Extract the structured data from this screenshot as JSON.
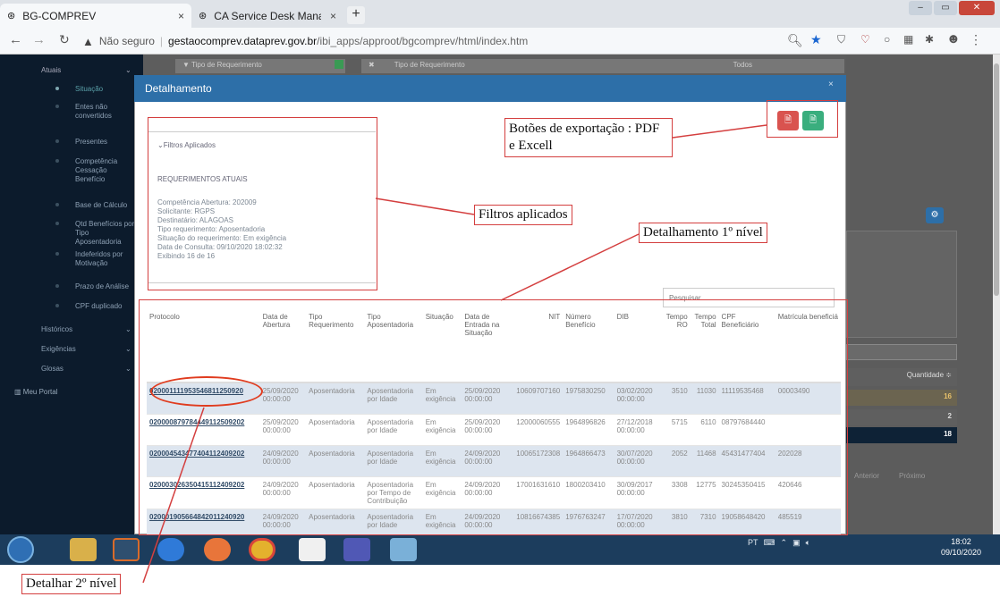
{
  "browser": {
    "tabs": [
      {
        "title": "BG-COMPREV",
        "close": "×"
      },
      {
        "title": "CA Service Desk Manager - S54 |",
        "close": "×"
      }
    ],
    "new_tab": "+",
    "security": "Não seguro",
    "url_host": "gestaocomprev.dataprev.gov.br",
    "url_path": "/ibi_apps/approot/bgcomprev/html/index.htm"
  },
  "sidebar": {
    "items": [
      {
        "label": "Atuais"
      },
      {
        "label": "Situação"
      },
      {
        "label": "Entes não convertidos"
      },
      {
        "label": "Presentes"
      },
      {
        "label": "Competência Cessação Benefício"
      },
      {
        "label": "Base de Cálculo"
      },
      {
        "label": "Qtd Benefícios por Tipo Aposentadoria"
      },
      {
        "label": "Indeferidos por Motivação"
      },
      {
        "label": "Prazo de Análise"
      },
      {
        "label": "CPF duplicado"
      },
      {
        "label": "Históricos"
      },
      {
        "label": "Exigências"
      },
      {
        "label": "Glosas"
      },
      {
        "label": "Meu Portal"
      }
    ]
  },
  "background": {
    "filter_label": "Tipo de Requerimento",
    "filter_label2": "Tipo de Requerimento",
    "filter_value": "Todos",
    "qty_header": "Quantidade ≑",
    "qty_values": [
      "16",
      "2",
      "18"
    ],
    "prev": "Anterior",
    "next": "Próximo"
  },
  "modal": {
    "title": "Detalhamento",
    "close": "×",
    "filters_toggle": "Filtros Aplicados",
    "subtitle": "REQUERIMENTOS ATUAIS",
    "filter_lines": [
      "Competência Abertura: 202009",
      "Solicitante: RGPS",
      "Destinatário: ALAGOAS",
      "Tipo requerimento: Aposentadoria",
      "Situação do requerimento: Em exigência",
      "Data de Consulta: 09/10/2020 18:02:32",
      "Exibindo 16 de 16"
    ],
    "search_placeholder": "Pesquisar",
    "columns": [
      "Protocolo",
      "Data de Abertura",
      "Tipo Requerimento",
      "Tipo Aposentadoria",
      "Situação",
      "Data de Entrada na Situação",
      "NIT",
      "Número Benefício",
      "DIB",
      "Tempo RO",
      "Tempo Total",
      "CPF Beneficiário",
      "Matrícula beneficiá"
    ],
    "rows": [
      [
        "020001111953546811250920",
        "25/09/2020 00:00:00",
        "Aposentadoria",
        "Aposentadoria por Idade",
        "Em exigência",
        "25/09/2020 00:00:00",
        "10609707160",
        "1975830250",
        "03/02/2020 00:00:00",
        "3510",
        "11030",
        "11119535468",
        "00003490"
      ],
      [
        "020000879784449112509202",
        "25/09/2020 00:00:00",
        "Aposentadoria",
        "Aposentadoria por Idade",
        "Em exigência",
        "25/09/2020 00:00:00",
        "12000060555",
        "1964896826",
        "27/12/2018 00:00:00",
        "5715",
        "6110",
        "08797684440",
        ""
      ],
      [
        "020004543477404112409202",
        "24/09/2020 00:00:00",
        "Aposentadoria",
        "Aposentadoria por Idade",
        "Em exigência",
        "24/09/2020 00:00:00",
        "10065172308",
        "1964866473",
        "30/07/2020 00:00:00",
        "2052",
        "11468",
        "45431477404",
        "202028"
      ],
      [
        "020003026350415112409202",
        "24/09/2020 00:00:00",
        "Aposentadoria",
        "Aposentadoria por Tempo de Contribuição",
        "Em exigência",
        "24/09/2020 00:00:00",
        "17001631610",
        "1800203410",
        "30/09/2017 00:00:00",
        "3308",
        "12775",
        "30245350415",
        "420646"
      ],
      [
        "020001905664842011240920",
        "24/09/2020 00:00:00",
        "Aposentadoria",
        "Aposentadoria por Idade",
        "Em exigência",
        "24/09/2020 00:00:00",
        "10816674385",
        "1976763247",
        "17/07/2020 00:00:00",
        "3810",
        "7310",
        "19058648420",
        "485519"
      ]
    ],
    "pdf_icon": "pdf-icon",
    "excel_icon": "excel-icon"
  },
  "annotations": {
    "export": "Botões de exportação : PDF e Excell",
    "filters": "Filtros aplicados",
    "level1": "Detalhamento 1º nível",
    "level2": "Detalhar 2º nível"
  },
  "taskbar": {
    "tray": "PT",
    "time": "18:02",
    "date": "09/10/2020"
  },
  "colors": {
    "modal_header": "#2d6fa8",
    "annotation": "#d43f3f",
    "pdf": "#d9534f",
    "excel": "#3aae7e"
  }
}
